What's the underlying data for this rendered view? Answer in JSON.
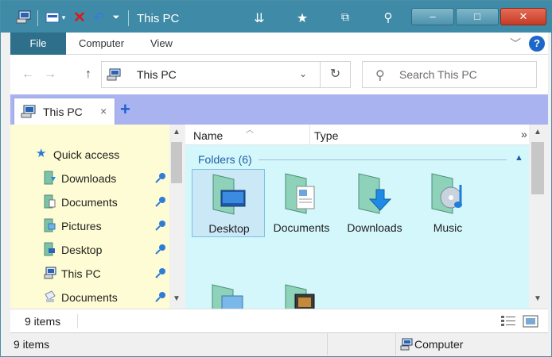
{
  "window": {
    "title": "This PC",
    "minimize_label": "–",
    "maximize_label": "□",
    "close_label": "✕"
  },
  "ribbon": {
    "tabs": [
      "File",
      "Computer",
      "View"
    ]
  },
  "address": {
    "path": "This PC",
    "search_placeholder": "Search This PC"
  },
  "tabs": [
    {
      "label": "This PC",
      "close": "×"
    }
  ],
  "new_tab_label": "+",
  "nav": {
    "quick_access": "Quick access",
    "items": [
      {
        "label": "Downloads",
        "icon": "downloads-folder-icon",
        "pinned": true
      },
      {
        "label": "Documents",
        "icon": "documents-folder-icon",
        "pinned": true
      },
      {
        "label": "Pictures",
        "icon": "pictures-folder-icon",
        "pinned": true
      },
      {
        "label": "Desktop",
        "icon": "desktop-folder-icon",
        "pinned": true
      },
      {
        "label": "This PC",
        "icon": "computer-icon",
        "pinned": true
      },
      {
        "label": "Documents",
        "icon": "documents-library-icon",
        "pinned": true
      }
    ]
  },
  "columns": [
    "Name",
    "Type"
  ],
  "more_columns": "»",
  "group": {
    "header": "Folders (6)",
    "folders": [
      {
        "label": "Desktop",
        "icon": "desktop-folder-icon",
        "selected": true
      },
      {
        "label": "Documents",
        "icon": "documents-folder-icon",
        "selected": false
      },
      {
        "label": "Downloads",
        "icon": "downloads-folder-icon",
        "selected": false
      },
      {
        "label": "Music",
        "icon": "music-folder-icon",
        "selected": false
      },
      {
        "label": "",
        "icon": "pictures-folder-icon",
        "selected": false
      },
      {
        "label": "",
        "icon": "videos-folder-icon",
        "selected": false
      }
    ]
  },
  "status": {
    "item_count": "9 items",
    "item_count_bottom": "9 items",
    "location": "Computer"
  },
  "colors": {
    "titlebar": "#3f8aa6",
    "tabstrip": "#a9b3f0",
    "nav_bg": "#fdfcd4",
    "content_bg": "#d4f7fb",
    "file_tab": "#2e6f8c",
    "group_header": "#1f5ea8"
  }
}
